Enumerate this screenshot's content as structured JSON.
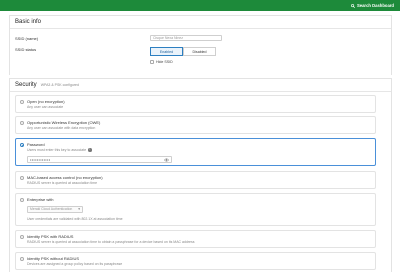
{
  "header": {
    "search_label": "Search Dashboard",
    "accent": "#1d8a3a"
  },
  "basic": {
    "title": "Basic info",
    "ssid_name_label": "SSID (name)",
    "ssid_name_placeholder": "Cisque Nexa Ninez",
    "ssid_status_label": "SSID status",
    "enabled_label": "Enabled",
    "disabled_label": "Disabled",
    "status_selected": "Enabled",
    "hide_ssid_label": "Hide SSID"
  },
  "security": {
    "title": "Security",
    "subtitle": "WPA3 & PSK configured",
    "options": [
      {
        "title": "Open (no encryption)",
        "desc": "Any user can associate"
      },
      {
        "title": "Opportunistic Wireless Encryption (OWE)",
        "desc": "Any user can associate with data encryption"
      },
      {
        "title": "Password",
        "desc": "Users must enter this key to associate",
        "password": "••••••••••••"
      },
      {
        "title": "MAC-based access control (no encryption)",
        "desc": "RADIUS server is queried at association time"
      },
      {
        "title": "Enterprise with",
        "desc": "User credentials are validated with 802.1X at association time",
        "dropdown": "Meraki Cloud Authentication"
      },
      {
        "title": "Identity PSK with RADIUS",
        "desc": "RADIUS server is queried at association time to obtain a passphrase for a device based on its MAC address"
      },
      {
        "title": "Identity PSK without RADIUS",
        "desc": "Devices are assigned a group policy based on its passphrase"
      }
    ],
    "selected_index": 2,
    "selected_color": "#2d7fc1"
  }
}
